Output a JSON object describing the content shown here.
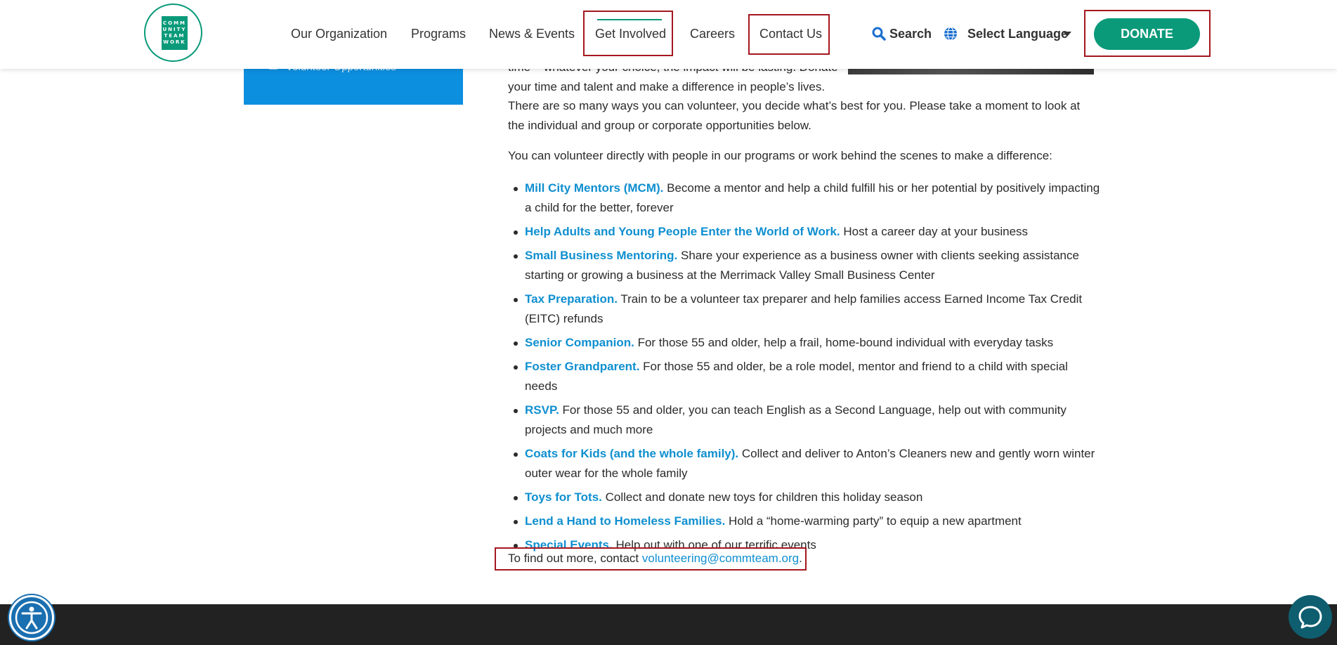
{
  "logo": {
    "text": "COMM UNITY TEAM WORK"
  },
  "nav": {
    "items": [
      "Our Organization",
      "Programs",
      "News & Events",
      "Get Involved",
      "Careers",
      "Contact Us"
    ],
    "search_label": "Search",
    "language_label": "Select Language",
    "donate_label": "DONATE"
  },
  "sidebar": {
    "item": "Volunteer Opportunities"
  },
  "content": {
    "partial_line1": "time – whatever your choice, the impact will be lasting.  Donate",
    "partial_line2": "your time and talent and make a difference in people’s lives.",
    "intro": "There are so many ways you can volunteer, you decide what’s best for you.  Please take a moment to look at the individual and group or corporate opportunities below.",
    "direct": "You can volunteer directly with people in our programs or work behind the scenes to make a difference:",
    "list": [
      {
        "title": "Mill City Mentors (MCM).",
        "text": "  Become a mentor and help a child fulfill his or her potential by positively impacting a child for the better, forever"
      },
      {
        "title": "Help Adults and Young People Enter the World of Work.",
        "text": "  Host a career day at your business"
      },
      {
        "title": "Small Business Mentoring.",
        "text": " Share your experience as a business owner with clients seeking assistance starting or growing a business at the Merrimack Valley Small Business Center"
      },
      {
        "title": "Tax Preparation.",
        "text": " Train to be a volunteer tax preparer and help families access Earned Income Tax Credit (EITC) refunds"
      },
      {
        "title": "Senior Companion.",
        "text": " For those 55 and older, help a frail, home-bound individual with everyday tasks"
      },
      {
        "title": "Foster Grandparent.",
        "text": " For those 55 and older, be a role model, mentor and friend to a child with special needs"
      },
      {
        "title": "RSVP.",
        "text": "  For those 55 and older, you can teach English as a Second Language, help out with community projects and much more"
      },
      {
        "title": "Coats for Kids (and the whole family).",
        "text": " Collect and deliver to Anton’s Cleaners new and gently worn winter outer wear for the whole family"
      },
      {
        "title": "Toys for Tots.",
        "text": "  Collect and donate new toys for children this holiday season"
      },
      {
        "title": "Lend a Hand to Homeless Families.",
        "text": " Hold a “home-warming party” to equip a new apartment"
      },
      {
        "title": "Special Events.",
        "text": " Help out with one of our terrific events"
      }
    ],
    "contact_prefix": "To find out more, contact ",
    "contact_email": "volunteering@commteam.org",
    "contact_suffix": "."
  }
}
